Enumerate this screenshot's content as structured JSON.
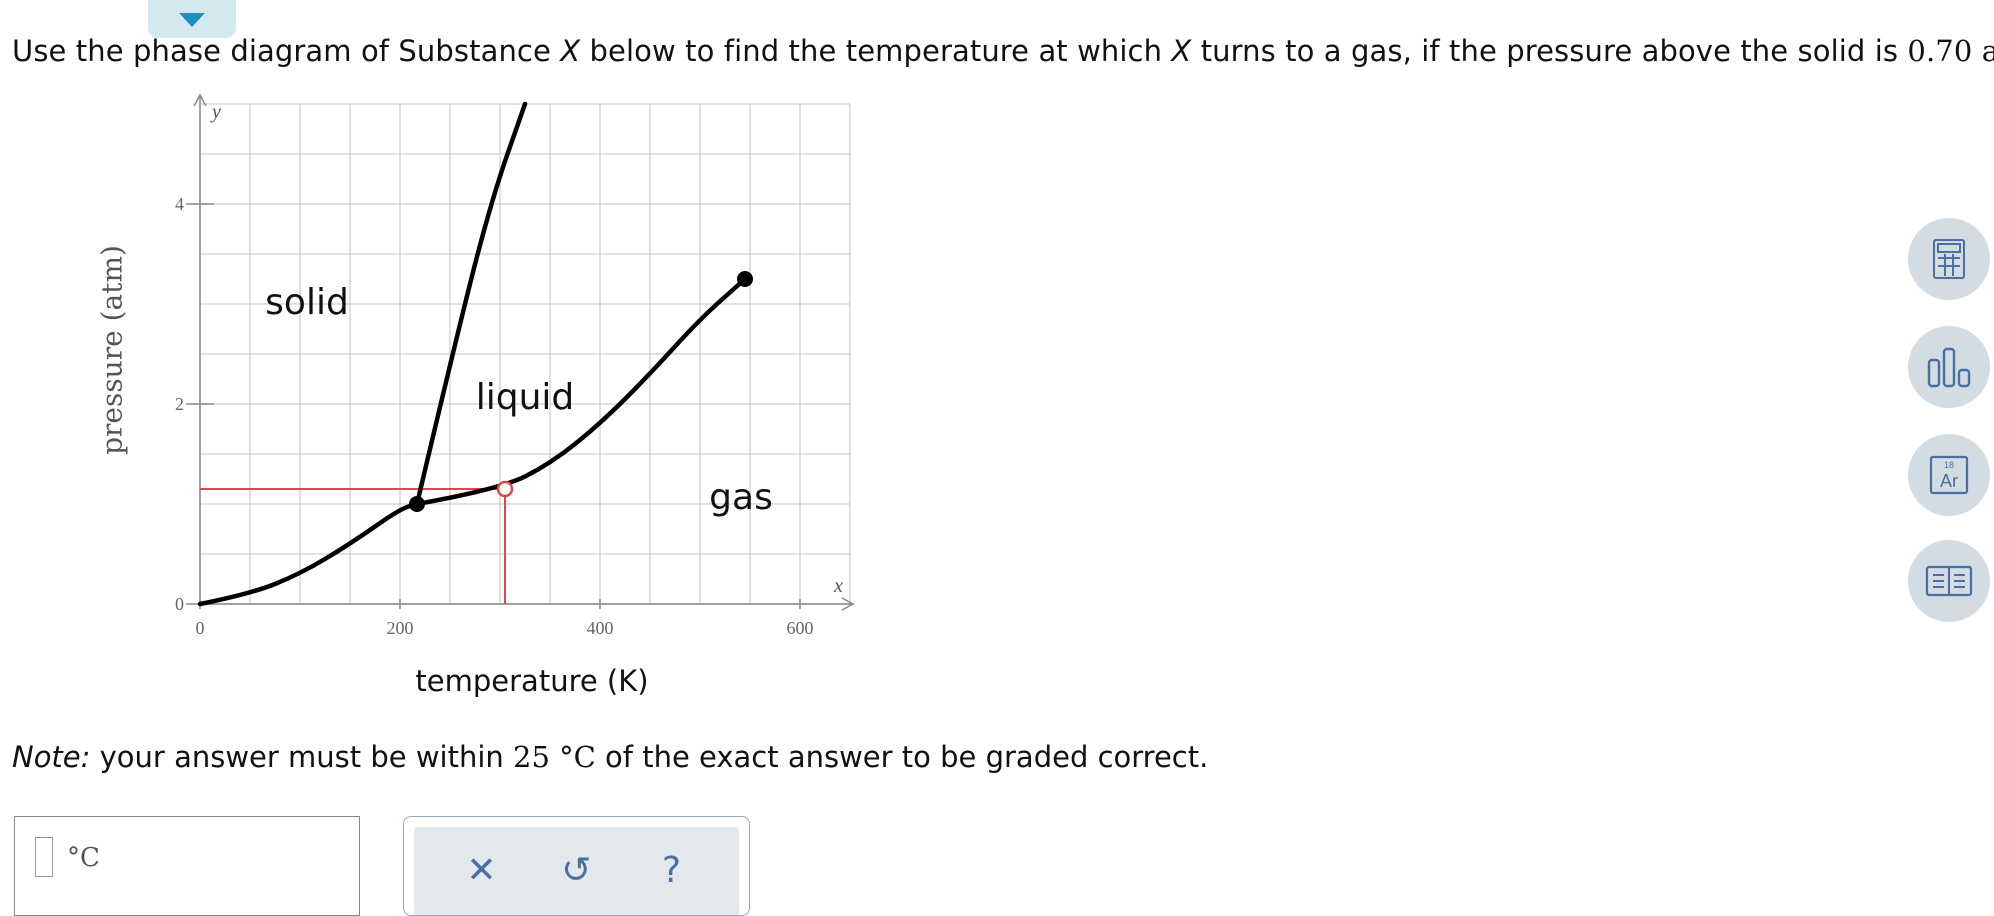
{
  "question": {
    "pre": "Use the phase diagram of Substance ",
    "var": "X",
    "mid1": " below to find the temperature at which ",
    "var2": "X",
    "mid2": " turns to a gas, if the pressure above the solid is ",
    "value": "0.70",
    "unit": " atm",
    "end": "."
  },
  "note": {
    "label": "Note:",
    "text1": " your answer must be within ",
    "tolerance": "25 °C",
    "text2": " of the exact answer to be graded correct."
  },
  "chart_data": {
    "type": "line",
    "xlabel": "temperature (K)",
    "ylabel": "pressure (atm)",
    "x_axis_symbol": "x",
    "y_axis_symbol": "y",
    "xlim": [
      0,
      650
    ],
    "ylim": [
      0,
      5
    ],
    "xticks": [
      0,
      200,
      400,
      600
    ],
    "yticks": [
      0,
      2,
      4
    ],
    "grid": true,
    "regions": [
      {
        "label": "solid",
        "x": 107,
        "y": 2.9
      },
      {
        "label": "liquid",
        "x": 325,
        "y": 1.95
      },
      {
        "label": "gas",
        "x": 541,
        "y": 0.95
      }
    ],
    "series": [
      {
        "points": [
          [
            0,
            0
          ],
          [
            50,
            0.1
          ],
          [
            100,
            0.3
          ],
          [
            150,
            0.6
          ],
          [
            200,
            0.95
          ],
          [
            217,
            1.0
          ]
        ]
      },
      {
        "points": [
          [
            217,
            1.0
          ],
          [
            300,
            1.15
          ],
          [
            350,
            1.4
          ],
          [
            400,
            1.8
          ],
          [
            450,
            2.3
          ],
          [
            500,
            2.85
          ],
          [
            545,
            3.25
          ]
        ]
      },
      {
        "points": [
          [
            217,
            1.0
          ],
          [
            250,
            2.4
          ],
          [
            290,
            4.0
          ],
          [
            325,
            5.0
          ]
        ]
      }
    ],
    "special_points": [
      {
        "x": 217,
        "y": 1.0,
        "style": "filled"
      },
      {
        "x": 545,
        "y": 3.25,
        "style": "filled"
      },
      {
        "x": 305,
        "y": 1.15,
        "style": "open-red"
      }
    ],
    "guide_lines": {
      "x": 305,
      "y": 1.15,
      "color": "#e0474c"
    },
    "colors": {
      "curve": "#000000",
      "grid": "#cfcfcf",
      "guide": "#e0474c"
    }
  },
  "answer": {
    "unit": "°C",
    "value": ""
  },
  "toolbar": {
    "clear": "✕",
    "undo": "↺",
    "help": "?"
  },
  "sidebar": {
    "calculator": "calculator-icon",
    "chart": "bar-chart-icon",
    "periodic": {
      "number": "18",
      "symbol": "Ar"
    },
    "reference": "book-icon"
  }
}
